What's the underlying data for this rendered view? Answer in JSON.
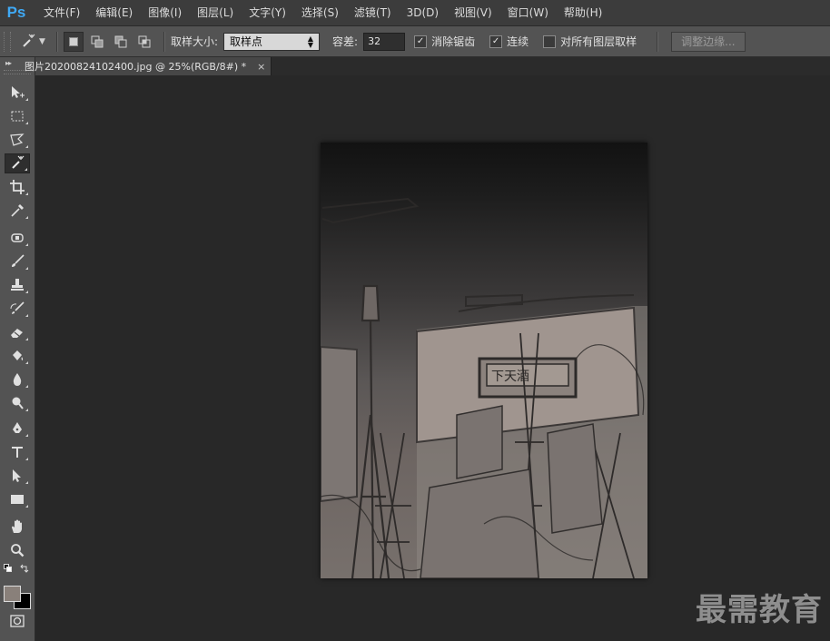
{
  "app": {
    "logo": "Ps"
  },
  "menu": [
    "文件(F)",
    "编辑(E)",
    "图像(I)",
    "图层(L)",
    "文字(Y)",
    "选择(S)",
    "滤镜(T)",
    "3D(D)",
    "视图(V)",
    "窗口(W)",
    "帮助(H)"
  ],
  "options": {
    "sample_size_label": "取样大小:",
    "sample_size_value": "取样点",
    "tolerance_label": "容差:",
    "tolerance_value": "32",
    "anti_alias_label": "消除锯齿",
    "anti_alias_checked": true,
    "contiguous_label": "连续",
    "contiguous_checked": true,
    "sample_all_layers_label": "对所有图层取样",
    "sample_all_layers_checked": false,
    "refine_edge_label": "调整边缘..."
  },
  "toolbar": {
    "collapse_glyph": "▸▸"
  },
  "document": {
    "tab_title": "图片20200824102400.jpg @ 25%(RGB/8#) *",
    "close_glyph": "×"
  },
  "colors": {
    "foreground": "#89807a",
    "background": "#000000"
  },
  "canvas_image": {
    "sign_text": "下天酒"
  },
  "watermark": "最需教育"
}
